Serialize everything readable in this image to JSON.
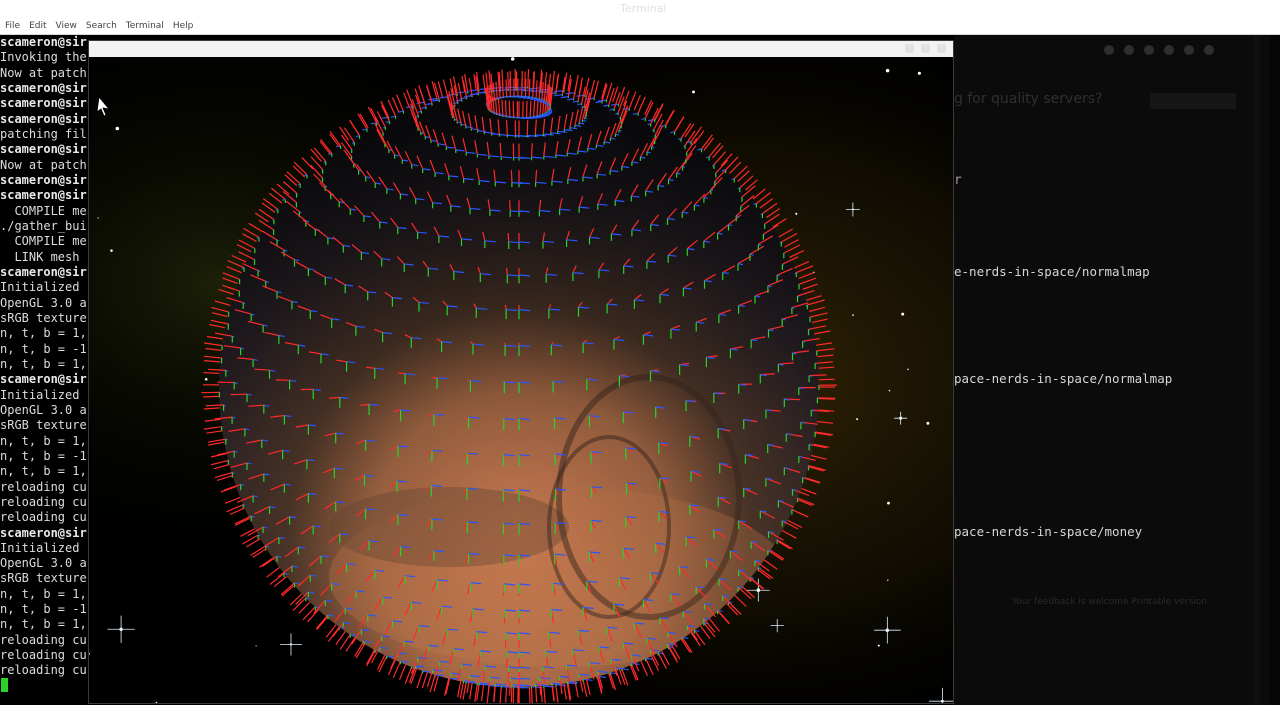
{
  "window_title": "Terminal",
  "menubar": [
    "File",
    "Edit",
    "View",
    "Search",
    "Terminal",
    "Help"
  ],
  "terminal": {
    "lines": [
      {
        "t": "scameron@sir",
        "k": "prompt"
      },
      {
        "t": "Invoking the",
        "k": "out"
      },
      {
        "t": "Now at patch",
        "k": "out"
      },
      {
        "t": "scameron@sir",
        "k": "prompt"
      },
      {
        "t": "scameron@sir",
        "k": "prompt"
      },
      {
        "t": "scameron@sir",
        "k": "prompt"
      },
      {
        "t": "patching fil",
        "k": "out"
      },
      {
        "t": "scameron@sir",
        "k": "prompt"
      },
      {
        "t": "Now at patch",
        "k": "out"
      },
      {
        "t": "scameron@sir",
        "k": "prompt"
      },
      {
        "t": "scameron@sir",
        "k": "prompt"
      },
      {
        "t": "  COMPILE me",
        "k": "out"
      },
      {
        "t": "./gather_bui",
        "k": "out"
      },
      {
        "t": "  COMPILE me",
        "k": "out"
      },
      {
        "t": "  LINK mesh",
        "k": "out"
      },
      {
        "t": "scameron@sir",
        "k": "prompt"
      },
      {
        "t": "Initialized",
        "k": "out"
      },
      {
        "t": "OpenGL 3.0 a",
        "k": "out"
      },
      {
        "t": "sRGB texture",
        "k": "out"
      },
      {
        "t": "n, t, b = 1,",
        "k": "out"
      },
      {
        "t": "n, t, b = -1",
        "k": "out"
      },
      {
        "t": "n, t, b = 1,",
        "k": "out"
      },
      {
        "t": "scameron@sir",
        "k": "prompt"
      },
      {
        "t": "Initialized",
        "k": "out"
      },
      {
        "t": "OpenGL 3.0 a",
        "k": "out"
      },
      {
        "t": "sRGB texture",
        "k": "out"
      },
      {
        "t": "n, t, b = 1,",
        "k": "out"
      },
      {
        "t": "n, t, b = -1",
        "k": "out"
      },
      {
        "t": "n, t, b = 1,",
        "k": "out"
      },
      {
        "t": "reloading cu",
        "k": "out"
      },
      {
        "t": "reloading cu",
        "k": "out"
      },
      {
        "t": "reloading cu",
        "k": "out"
      },
      {
        "t": "scameron@sir",
        "k": "prompt"
      },
      {
        "t": "Initialized",
        "k": "out"
      },
      {
        "t": "OpenGL 3.0 a",
        "k": "out"
      },
      {
        "t": "sRGB texture",
        "k": "out"
      },
      {
        "t": "n, t, b = 1,",
        "k": "out"
      },
      {
        "t": "n, t, b = -1",
        "k": "out"
      },
      {
        "t": "n, t, b = 1,",
        "k": "out"
      },
      {
        "t": "reloading cu",
        "k": "out"
      },
      {
        "t": "reloading cu",
        "k": "out"
      },
      {
        "t": "reloading cu",
        "k": "out"
      }
    ]
  },
  "background_page": {
    "heading": "g for quality servers?",
    "letter": "r",
    "paths": [
      "e-nerds-in-space/normalmap",
      "pace-nerds-in-space/normalmap",
      "pace-nerds-in-space/money"
    ],
    "footer": "Your feedback is welcome   Printable version"
  },
  "colors": {
    "normal": "#ff2a2a",
    "tangent": "#2a55ff",
    "bitangent": "#2ad22a",
    "cursor": "#2bd22b"
  }
}
